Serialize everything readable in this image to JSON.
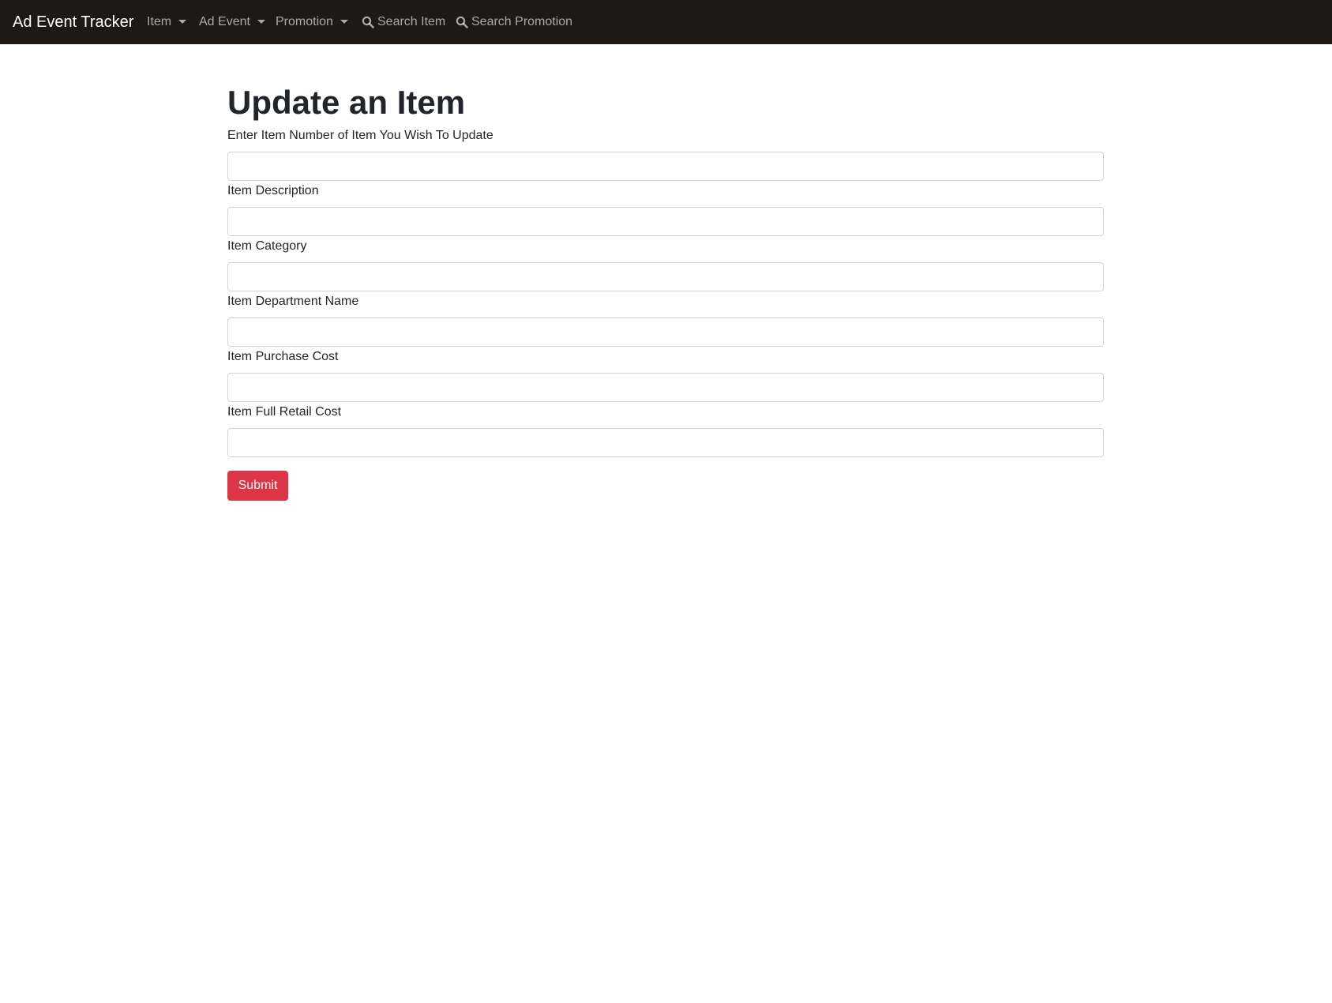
{
  "navbar": {
    "brand": "Ad Event Tracker",
    "items": [
      {
        "label": "Item",
        "icon": "caret-down-icon"
      },
      {
        "label": "Ad Event",
        "icon": "caret-down-icon"
      },
      {
        "label": "Promotion",
        "icon": "caret-down-icon"
      },
      {
        "label": "Search Item",
        "icon": "search-icon"
      },
      {
        "label": "Search Promotion",
        "icon": "search-icon"
      }
    ]
  },
  "page": {
    "title": "Update an Item"
  },
  "form": {
    "fields": [
      {
        "label": "Enter Item Number of Item You Wish To Update",
        "value": ""
      },
      {
        "label": "Item Description",
        "value": ""
      },
      {
        "label": "Item Category",
        "value": ""
      },
      {
        "label": "Item Department Name",
        "value": ""
      },
      {
        "label": "Item Purchase Cost",
        "value": ""
      },
      {
        "label": "Item Full Retail Cost",
        "value": ""
      }
    ],
    "submit_label": "Submit"
  },
  "colors": {
    "navbar_bg": "#201814",
    "submit_bg": "#dc3545"
  }
}
